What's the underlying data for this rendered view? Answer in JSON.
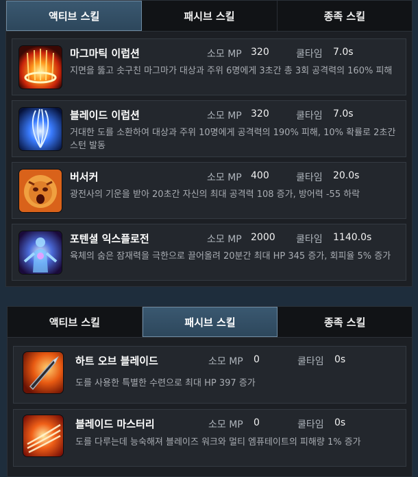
{
  "panel_top": {
    "tabs": [
      {
        "label": "액티브 스킬",
        "active": true
      },
      {
        "label": "패시브 스킬",
        "active": false
      },
      {
        "label": "종족 스킬",
        "active": false
      }
    ],
    "skills": [
      {
        "name": "마그마틱 이럽션",
        "mp_label": "소모 MP",
        "mp": "320",
        "cd_label": "쿨타임",
        "cd": "7.0s",
        "desc": "지면을 뚫고 솟구친 마그마가 대상과 주위 6명에게 3초간 총 3회 공격력의 160% 피해",
        "icon": "magma-eruption-icon"
      },
      {
        "name": "블레이드 이럽션",
        "mp_label": "소모 MP",
        "mp": "320",
        "cd_label": "쿨타임",
        "cd": "7.0s",
        "desc": "거대한 도를 소환하여 대상과 주위 10명에게 공격력의 190% 피해, 10% 확률로 2초간 스턴 발동",
        "icon": "blade-eruption-icon"
      },
      {
        "name": "버서커",
        "mp_label": "소모 MP",
        "mp": "400",
        "cd_label": "쿨타임",
        "cd": "20.0s",
        "desc": "광전사의 기운을 받아 20초간 자신의 최대 공격력 108 증가, 방어력 -55 하락",
        "icon": "berserker-icon"
      },
      {
        "name": "포텐셜 익스플로전",
        "mp_label": "소모 MP",
        "mp": "2000",
        "cd_label": "쿨타임",
        "cd": "1140.0s",
        "desc": "육체의 숨은 잠재력을 극한으로 끌어올려 20분간 최대 HP 345 증가, 회피율 5% 증가",
        "icon": "potential-explosion-icon"
      }
    ]
  },
  "panel_bottom": {
    "tabs": [
      {
        "label": "액티브 스킬",
        "active": false
      },
      {
        "label": "패시브 스킬",
        "active": true
      },
      {
        "label": "종족 스킬",
        "active": false
      }
    ],
    "skills": [
      {
        "name": "하트 오브 블레이드",
        "mp_label": "소모 MP",
        "mp": "0",
        "cd_label": "쿨타임",
        "cd": "0s",
        "desc": "도를 사용한 특별한 수련으로 최대 HP 397 증가",
        "icon": "heart-of-blade-icon"
      },
      {
        "name": "블레이드 마스터리",
        "mp_label": "소모 MP",
        "mp": "0",
        "cd_label": "쿨타임",
        "cd": "0s",
        "desc": "도를 다루는데 능숙해져 블레이즈 워크와 멀티 엠퓨테이트의 피해량 1% 증가",
        "icon": "blade-mastery-icon"
      }
    ]
  },
  "colors": {
    "active_tab": "#3a5870",
    "background": "#1e2d3c"
  }
}
